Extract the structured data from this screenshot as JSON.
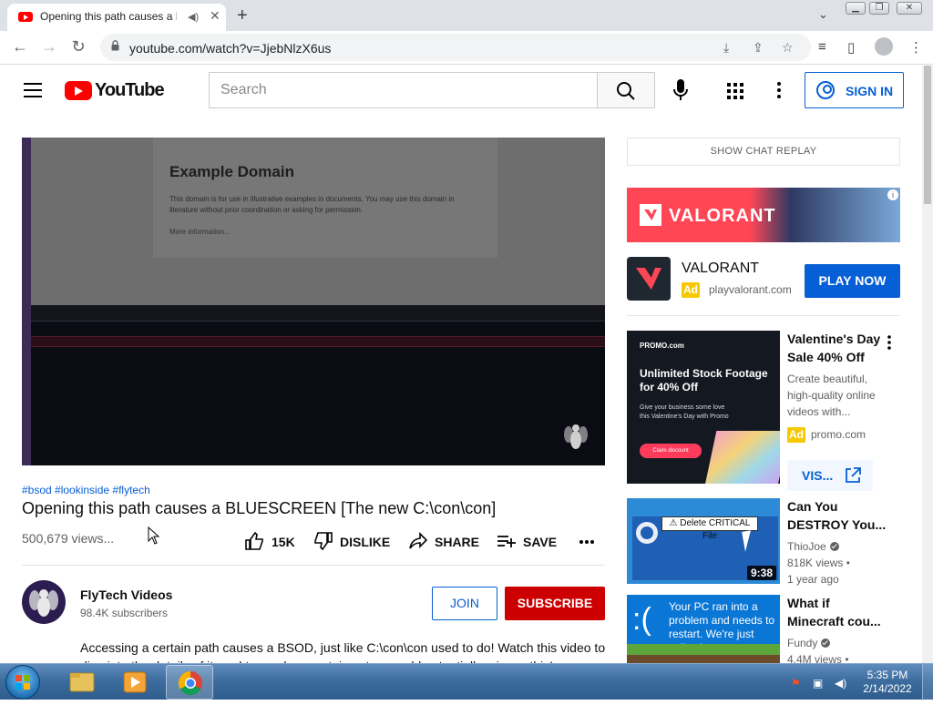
{
  "browser": {
    "tab_title": "Opening this path causes a B",
    "url": "youtube.com/watch?v=JjebNlzX6us"
  },
  "header": {
    "logo_text": "YouTube",
    "search_placeholder": "Search",
    "sign_in_label": "SIGN IN"
  },
  "video": {
    "page_heading": "Example Domain",
    "page_text": "This domain is for use in illustrative examples in documents. You may use this domain in literature without prior coordination or asking for permission.",
    "page_link": "More information...",
    "hashtags": "#bsod #lookinside #flytech",
    "title": "Opening this path causes a BLUESCREEN [The new C:\\con\\con]",
    "views": "500,679 views...",
    "likes": "15K",
    "dislike_label": "DISLIKE",
    "share_label": "SHARE",
    "save_label": "SAVE"
  },
  "channel": {
    "name": "FlyTech Videos",
    "subscribers": "98.4K subscribers",
    "join_label": "JOIN",
    "subscribe_label": "SUBSCRIBE"
  },
  "description": "Accessing a certain path causes a BSOD, just like C:\\con\\con used to do! Watch this video to dive into the details of it, and to see how certain actors could potentially misuse this!",
  "sidebar": {
    "chat_replay_label": "SHOW CHAT REPLAY",
    "ad": {
      "banner_brand": "VALORANT",
      "info": "i",
      "title": "VALORANT",
      "badge": "Ad",
      "domain": "playvalorant.com",
      "cta": "PLAY NOW"
    },
    "promo": {
      "thumb_logo": "PROMO.com",
      "thumb_headline": "Unlimited Stock Footage for 40% Off",
      "thumb_body": "Give your business some love this Valentine's Day with Promo",
      "thumb_cta": "Claim discount",
      "title": "Valentine's Day Sale 40% Off",
      "description": "Create beautiful, high-quality online videos with...",
      "badge": "Ad",
      "domain": "promo.com",
      "visit_label": "VIS..."
    },
    "recommendations": [
      {
        "title": "Can You DESTROY You...",
        "channel": "ThioJoe",
        "views": "818K views •",
        "age": "1 year ago",
        "duration": "9:38",
        "thumb_badge": "⚠ Delete CRITICAL File"
      },
      {
        "title": "What if Minecraft cou...",
        "channel": "Fundy",
        "views": "4.4M views •",
        "thumb_face": ":(",
        "thumb_text": "Your PC ran into a problem and needs to restart. We're just collecting some error info, and then we'll restart for you."
      }
    ]
  },
  "taskbar": {
    "time": "5:35 PM",
    "date": "2/14/2022"
  },
  "colors": {
    "youtube_red": "#ff0000",
    "link_blue": "#065fd4",
    "subscribe_red": "#cc0000",
    "ad_yellow": "#f7c800",
    "valorant_red": "#ff4655"
  }
}
